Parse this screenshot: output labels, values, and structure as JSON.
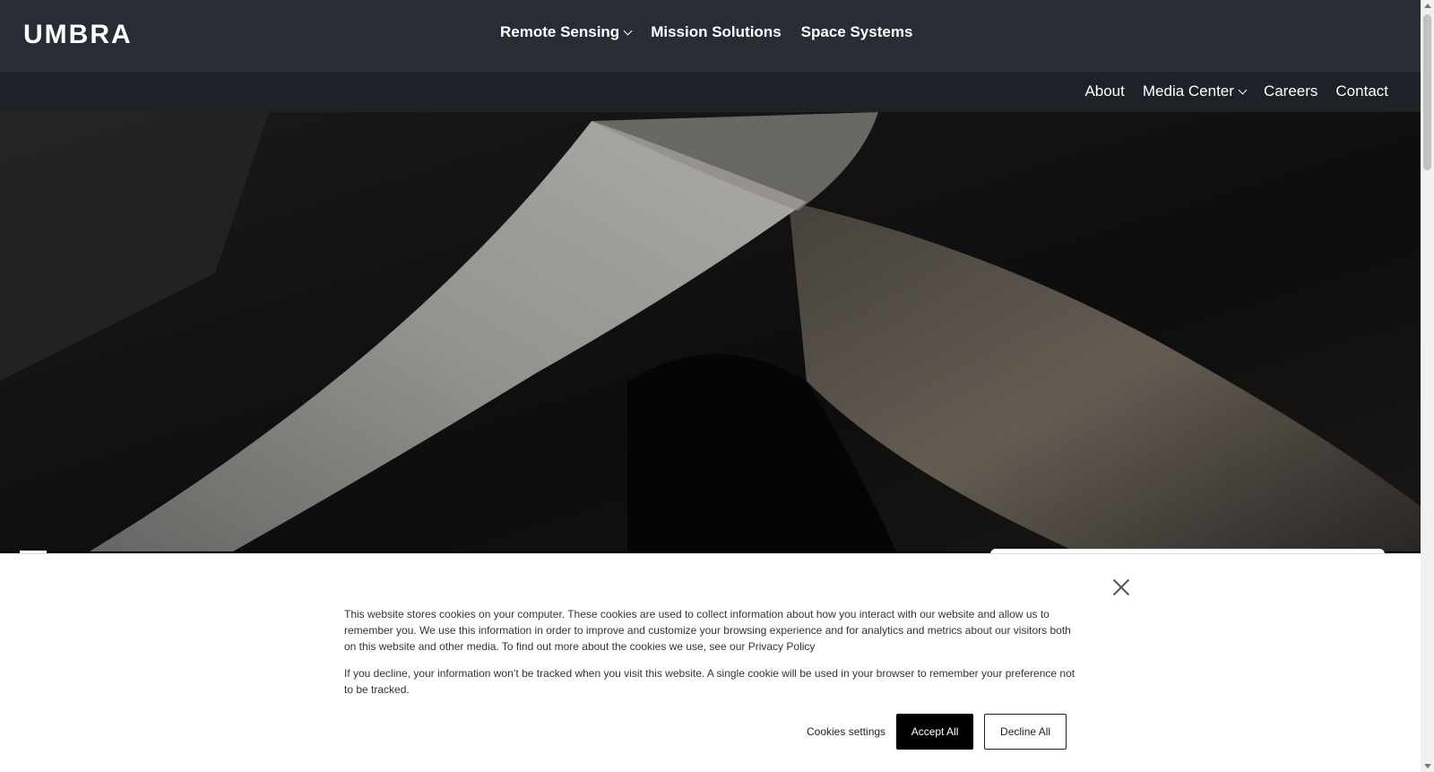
{
  "brand": {
    "logo_text": "UMBRA"
  },
  "main_nav": [
    {
      "label": "Remote Sensing",
      "has_dropdown": true
    },
    {
      "label": "Mission Solutions",
      "has_dropdown": false
    },
    {
      "label": "Space Systems",
      "has_dropdown": false
    }
  ],
  "sub_nav": [
    {
      "label": "About",
      "has_dropdown": false
    },
    {
      "label": "Media Center",
      "has_dropdown": true
    },
    {
      "label": "Careers",
      "has_dropdown": false
    },
    {
      "label": "Contact",
      "has_dropdown": false
    }
  ],
  "hero": {
    "image_subject": "satellite-radar-imagery-of-terrain"
  },
  "cookie_banner": {
    "paragraph_1": "This website stores cookies on your computer. These cookies are used to collect information about how you interact with our website and allow us to remember you. We use this information in order to improve and customize your browsing experience and for analytics and metrics about our visitors both on this website and other media. To find out more about the cookies we use, see our ",
    "privacy_link": "Privacy Policy",
    "paragraph_2": "If you decline, your information won’t be tracked when you visit this website. A single cookie will be used in your browser to remember your preference not to be tracked.",
    "settings_label": "Cookies settings",
    "accept_label": "Accept All",
    "decline_label": "Decline All"
  },
  "colors": {
    "topbar": "#282d35",
    "subbar": "#1e2128",
    "accept_bg": "#000000"
  }
}
